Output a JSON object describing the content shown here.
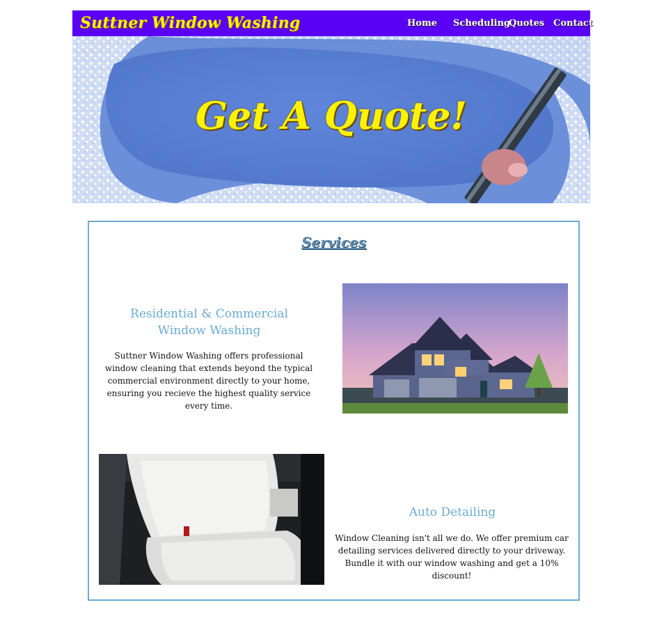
{
  "header": {
    "brand": "Suttner Window Washing",
    "nav": [
      "Home",
      "Scheduling",
      "Quotes",
      "Contact"
    ]
  },
  "hero": {
    "title": "Get A Quote!"
  },
  "services": {
    "title": "Services",
    "items": [
      {
        "heading": "Residential & Commercial Window Washing",
        "text": "Suttner Window Washing offers professional window cleaning that extends beyond the typical commercial environment directly to your home, ensuring you recieve the highest quality service every time."
      },
      {
        "heading": "Auto Detailing",
        "text": "Window Cleaning isn't all we do. We offer premium car detailing services delivered directly to your driveway. Bundle it with our window washing and get a 10% discount!"
      }
    ]
  },
  "colors": {
    "header_bg": "#5a00f5",
    "brand_yellow": "#fff200",
    "accent_blue": "#6aabd2"
  }
}
